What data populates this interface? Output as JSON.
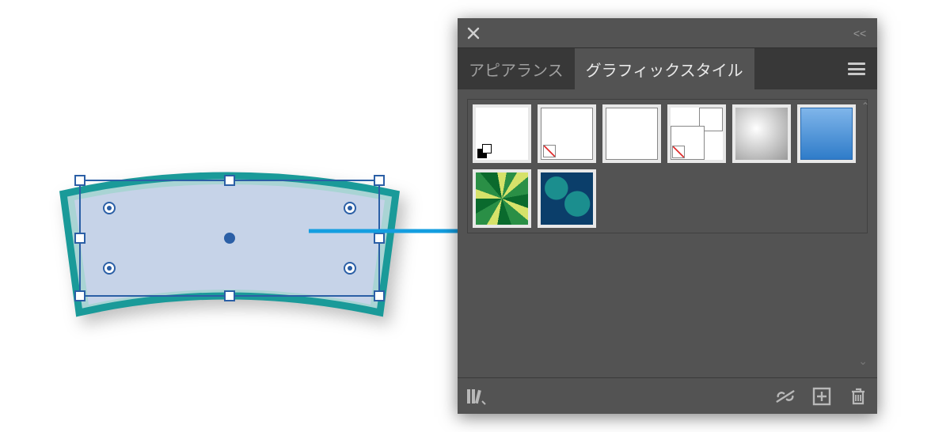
{
  "panel": {
    "tabs": [
      {
        "label": "アピアランス",
        "active": false
      },
      {
        "label": "グラフィックスタイル",
        "active": true
      }
    ],
    "styles": [
      {
        "name": "default-fill-stroke"
      },
      {
        "name": "no-fill"
      },
      {
        "name": "white-box"
      },
      {
        "name": "two-boxes-nofill"
      },
      {
        "name": "soft-gray-gradient"
      },
      {
        "name": "blue-gradient"
      },
      {
        "name": "green-leaf-pattern"
      },
      {
        "name": "blue-swirl-pattern"
      }
    ],
    "icons": {
      "close": "close-icon",
      "collapse": "collapse-icon",
      "menu": "menu-icon",
      "library": "library-icon",
      "breaklink": "break-link-icon",
      "new": "new-style-icon",
      "delete": "delete-icon"
    }
  },
  "artwork": {
    "fill": "#c6d3e8",
    "stroke": "#1a9a99",
    "innerFill": "#a9d4d4",
    "action": "drag-shape-to-graphic-styles-panel"
  }
}
